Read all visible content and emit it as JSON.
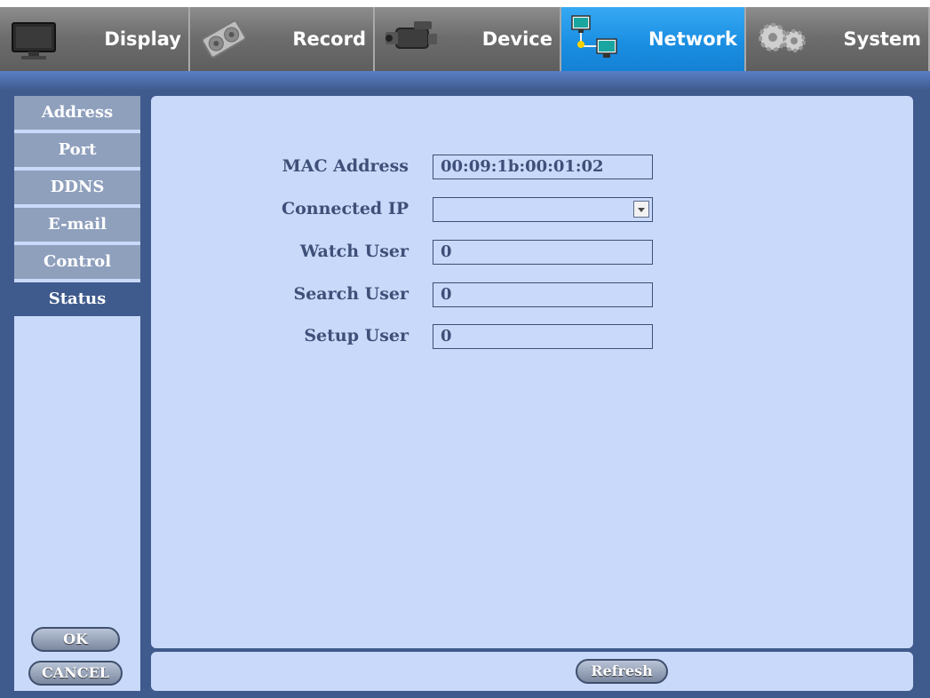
{
  "tabs": [
    {
      "id": "display",
      "label": "Display",
      "icon": "monitor-icon"
    },
    {
      "id": "record",
      "label": "Record",
      "icon": "film-reel-icon"
    },
    {
      "id": "device",
      "label": "Device",
      "icon": "video-camera-icon"
    },
    {
      "id": "network",
      "label": "Network",
      "icon": "network-computers-icon",
      "active": true
    },
    {
      "id": "system",
      "label": "System",
      "icon": "gears-icon"
    }
  ],
  "sidebar": {
    "items": [
      {
        "label": "Address"
      },
      {
        "label": "Port"
      },
      {
        "label": "DDNS"
      },
      {
        "label": "E-mail"
      },
      {
        "label": "Control"
      },
      {
        "label": "Status",
        "active": true
      }
    ],
    "ok_label": "OK",
    "cancel_label": "CANCEL"
  },
  "status": {
    "mac_address_label": "MAC Address",
    "mac_address_value": "00:09:1b:00:01:02",
    "connected_ip_label": "Connected IP",
    "connected_ip_value": "",
    "watch_user_label": "Watch User",
    "watch_user_value": "0",
    "search_user_label": "Search User",
    "search_user_value": "0",
    "setup_user_label": "Setup User",
    "setup_user_value": "0"
  },
  "footer": {
    "refresh_label": "Refresh"
  },
  "colors": {
    "active_tab": "#1b8fe3",
    "panel_bg": "#c9d9fa",
    "frame": "#3f5a8c",
    "sidebar_item": "#8fa0bd",
    "label_text": "#3e4f78"
  }
}
